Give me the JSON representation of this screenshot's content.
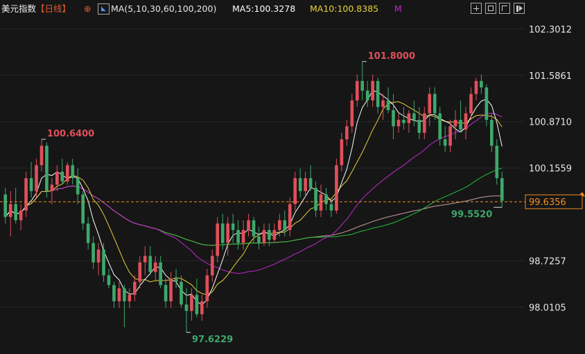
{
  "header": {
    "index_name": "美元指数",
    "period": "【日线】",
    "ma_params": "MA(5,10,30,60,100,200)",
    "ma5": "MA5:100.3278",
    "ma10": "MA10:100.8385",
    "ma_more": "M",
    "icons": [
      "crosshair-icon",
      "zoom-icon",
      "fullscreen-icon",
      "return-icon"
    ]
  },
  "colors": {
    "background": "#161616",
    "bull": "#e0505a",
    "bear": "#3ea86c",
    "ma5": "#ffffff",
    "ma10": "#e8d23a",
    "ma30": "#c02ad0",
    "ma60": "#22c03a",
    "ma100": "#9a9a9a",
    "ma200": "#d02a2a",
    "current_price": "#f09020"
  },
  "chart_data": {
    "type": "candlestick",
    "y_ticks": [
      "102.3012",
      "101.5861",
      "100.8710",
      "100.1559",
      "98.7257",
      "98.0105"
    ],
    "ylim": [
      97.5,
      102.45
    ],
    "current_price": "99.6356",
    "annotations": {
      "high": "101.8000",
      "low": "97.6229",
      "left_high": "100.6400",
      "recent_low": "99.5520"
    },
    "candles": [
      [
        99.75,
        99.85,
        99.3,
        99.4
      ],
      [
        99.4,
        99.8,
        99.1,
        99.6
      ],
      [
        99.6,
        99.85,
        99.3,
        99.35
      ],
      [
        99.35,
        99.6,
        99.2,
        99.5
      ],
      [
        99.5,
        100.1,
        99.4,
        100.0
      ],
      [
        100.0,
        100.25,
        99.7,
        99.8
      ],
      [
        99.8,
        100.3,
        99.7,
        100.2
      ],
      [
        100.2,
        100.6,
        100.1,
        100.5
      ],
      [
        100.5,
        100.55,
        99.7,
        99.8
      ],
      [
        99.8,
        100.0,
        99.6,
        99.9
      ],
      [
        99.9,
        100.2,
        99.8,
        100.1
      ],
      [
        100.1,
        100.3,
        99.9,
        99.95
      ],
      [
        99.95,
        100.25,
        99.9,
        100.2
      ],
      [
        100.2,
        100.3,
        99.9,
        100.0
      ],
      [
        100.0,
        100.15,
        99.6,
        99.75
      ],
      [
        99.75,
        99.8,
        99.2,
        99.3
      ],
      [
        99.3,
        99.4,
        98.9,
        99.0
      ],
      [
        99.0,
        99.1,
        98.6,
        98.7
      ],
      [
        98.7,
        99.0,
        98.5,
        98.9
      ],
      [
        98.9,
        99.0,
        98.4,
        98.5
      ],
      [
        98.5,
        98.6,
        98.3,
        98.35
      ],
      [
        98.35,
        98.4,
        98.0,
        98.1
      ],
      [
        98.1,
        98.4,
        98.0,
        98.3
      ],
      [
        98.3,
        98.35,
        97.7,
        98.1
      ],
      [
        98.1,
        98.3,
        98.0,
        98.2
      ],
      [
        98.2,
        98.5,
        98.1,
        98.4
      ],
      [
        98.4,
        98.8,
        98.3,
        98.7
      ],
      [
        98.7,
        98.95,
        98.5,
        98.8
      ],
      [
        98.8,
        98.95,
        98.5,
        98.55
      ],
      [
        98.55,
        98.8,
        98.4,
        98.7
      ],
      [
        98.7,
        98.8,
        98.3,
        98.35
      ],
      [
        98.35,
        98.45,
        98.0,
        98.1
      ],
      [
        98.1,
        98.55,
        98.0,
        98.45
      ],
      [
        98.45,
        98.6,
        98.3,
        98.4
      ],
      [
        98.4,
        98.5,
        98.0,
        98.05
      ],
      [
        98.05,
        98.3,
        97.62,
        97.95
      ],
      [
        97.95,
        98.3,
        97.8,
        98.2
      ],
      [
        98.2,
        98.45,
        97.85,
        97.9
      ],
      [
        97.9,
        98.2,
        97.8,
        98.1
      ],
      [
        98.1,
        98.6,
        98.0,
        98.5
      ],
      [
        98.5,
        98.9,
        98.4,
        98.8
      ],
      [
        98.8,
        99.4,
        98.7,
        99.3
      ],
      [
        99.3,
        99.45,
        98.9,
        99.0
      ],
      [
        99.0,
        99.4,
        98.8,
        99.3
      ],
      [
        99.3,
        99.45,
        99.0,
        99.2
      ],
      [
        99.2,
        99.35,
        98.9,
        99.0
      ],
      [
        99.0,
        99.35,
        98.9,
        99.2
      ],
      [
        99.2,
        99.45,
        99.1,
        99.35
      ],
      [
        99.35,
        99.4,
        99.0,
        99.1
      ],
      [
        99.1,
        99.25,
        98.9,
        99.0
      ],
      [
        99.0,
        99.3,
        98.95,
        99.2
      ],
      [
        99.2,
        99.3,
        98.95,
        99.05
      ],
      [
        99.05,
        99.3,
        99.0,
        99.2
      ],
      [
        99.2,
        99.45,
        99.1,
        99.35
      ],
      [
        99.35,
        99.5,
        99.1,
        99.2
      ],
      [
        99.2,
        99.7,
        99.1,
        99.6
      ],
      [
        99.6,
        100.1,
        99.5,
        100.0
      ],
      [
        100.0,
        100.15,
        99.7,
        99.8
      ],
      [
        99.8,
        100.1,
        99.7,
        100.0
      ],
      [
        100.0,
        100.2,
        99.8,
        99.85
      ],
      [
        99.85,
        99.95,
        99.4,
        99.5
      ],
      [
        99.5,
        99.9,
        99.4,
        99.75
      ],
      [
        99.75,
        99.85,
        99.5,
        99.6
      ],
      [
        99.6,
        99.7,
        99.4,
        99.5
      ],
      [
        99.5,
        100.3,
        99.45,
        100.2
      ],
      [
        100.2,
        100.7,
        100.1,
        100.6
      ],
      [
        100.6,
        100.9,
        100.5,
        100.8
      ],
      [
        100.8,
        101.3,
        100.7,
        101.2
      ],
      [
        101.2,
        101.6,
        101.1,
        101.5
      ],
      [
        101.5,
        101.8,
        101.2,
        101.35
      ],
      [
        101.35,
        101.5,
        101.1,
        101.2
      ],
      [
        101.2,
        101.6,
        101.1,
        101.5
      ],
      [
        101.5,
        101.55,
        101.0,
        101.1
      ],
      [
        101.1,
        101.3,
        100.9,
        101.2
      ],
      [
        101.2,
        101.4,
        101.0,
        101.05
      ],
      [
        101.05,
        101.3,
        100.6,
        100.8
      ],
      [
        100.8,
        101.0,
        100.7,
        100.9
      ],
      [
        100.9,
        101.1,
        100.75,
        100.85
      ],
      [
        100.85,
        101.05,
        100.7,
        101.0
      ],
      [
        101.0,
        101.2,
        100.8,
        100.9
      ],
      [
        100.9,
        101.1,
        100.6,
        100.7
      ],
      [
        100.7,
        101.1,
        100.6,
        101.0
      ],
      [
        101.0,
        101.4,
        100.8,
        101.3
      ],
      [
        101.3,
        101.4,
        100.9,
        101.0
      ],
      [
        101.0,
        101.1,
        100.5,
        100.6
      ],
      [
        100.6,
        100.8,
        100.4,
        100.5
      ],
      [
        100.5,
        100.9,
        100.4,
        100.8
      ],
      [
        100.8,
        101.05,
        100.6,
        100.9
      ],
      [
        100.9,
        101.2,
        100.7,
        100.75
      ],
      [
        100.75,
        101.1,
        100.6,
        101.0
      ],
      [
        101.0,
        101.4,
        100.9,
        101.3
      ],
      [
        101.3,
        101.55,
        101.2,
        101.5
      ],
      [
        101.5,
        101.6,
        101.3,
        101.4
      ],
      [
        101.4,
        101.45,
        100.8,
        100.9
      ],
      [
        100.9,
        101.0,
        100.4,
        100.5
      ],
      [
        100.5,
        100.6,
        99.9,
        100.0
      ],
      [
        100.0,
        100.1,
        99.55,
        99.65
      ]
    ]
  }
}
